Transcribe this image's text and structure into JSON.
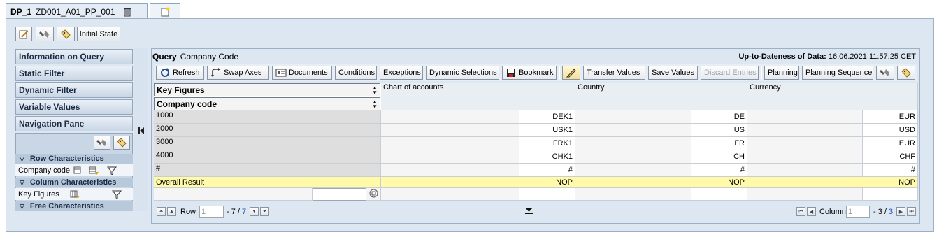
{
  "tabs": [
    {
      "label_bold": "DP_1",
      "label": "ZD001_A01_PP_001"
    }
  ],
  "toolbar": {
    "initial_state_label": "Initial State"
  },
  "left_nav": {
    "buttons": [
      "Information on Query",
      "Static Filter",
      "Dynamic Filter",
      "Variable Values",
      "Navigation Pane"
    ],
    "sections": {
      "row": "Row Characteristics",
      "column": "Column Characteristics",
      "free": "Free Characteristics"
    },
    "row_items": [
      "Company code"
    ],
    "column_items": [
      "Key Figures"
    ]
  },
  "query": {
    "label": "Query",
    "name": "Company Code",
    "date_label": "Up-to-Dateness of Data:",
    "date_value": "16.06.2021 11:57:25 CET"
  },
  "query_toolbar": {
    "refresh": "Refresh",
    "swap_axes": "Swap Axes",
    "documents": "Documents",
    "conditions": "Conditions",
    "exceptions": "Exceptions",
    "dynamic_selections": "Dynamic Selections",
    "bookmark": "Bookmark",
    "transfer_values": "Transfer Values",
    "save_values": "Save Values",
    "discard_entries": "Discard Entries",
    "planning": "Planning",
    "planning_sequence": "Planning Sequence"
  },
  "grid": {
    "key_figures": "Key Figures",
    "company_code": "Company code",
    "columns": [
      "Chart of accounts",
      "Country",
      "Currency"
    ],
    "rows": [
      {
        "code": "1000",
        "values": [
          "DEK1",
          "DE",
          "EUR"
        ]
      },
      {
        "code": "2000",
        "values": [
          "USK1",
          "US",
          "USD"
        ]
      },
      {
        "code": "3000",
        "values": [
          "FRK1",
          "FR",
          "EUR"
        ]
      },
      {
        "code": "4000",
        "values": [
          "CHK1",
          "CH",
          "CHF"
        ]
      },
      {
        "code": "#",
        "values": [
          "#",
          "#",
          "#"
        ]
      }
    ],
    "result": {
      "label": "Overall Result",
      "values": [
        "NOP",
        "NOP",
        "NOP"
      ]
    }
  },
  "scroll": {
    "row_label": "Row",
    "row_value": "1",
    "row_range_prefix": "- 7 /",
    "row_total": "7",
    "column_label": "Column",
    "column_value": "1",
    "column_range_prefix": "- 3 /",
    "column_total": "3"
  }
}
